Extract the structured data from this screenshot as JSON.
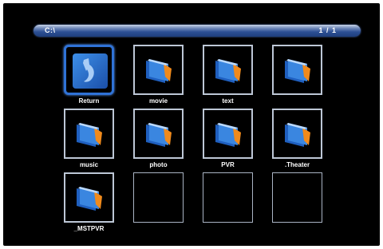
{
  "path_bar": {
    "path": "C:\\",
    "page": "1 / 1"
  },
  "items": [
    {
      "label": "Return",
      "icon": "return-arrow-icon",
      "type": "return"
    },
    {
      "label": "movie",
      "icon": "folder-icon",
      "type": "folder"
    },
    {
      "label": "text",
      "icon": "folder-icon",
      "type": "folder"
    },
    {
      "label": "",
      "icon": "folder-icon",
      "type": "folder"
    },
    {
      "label": "music",
      "icon": "folder-icon",
      "type": "folder"
    },
    {
      "label": "photo",
      "icon": "folder-icon",
      "type": "folder"
    },
    {
      "label": "PVR",
      "icon": "folder-icon",
      "type": "folder"
    },
    {
      "label": ".Theater",
      "icon": "folder-icon",
      "type": "folder"
    },
    {
      "label": "_MSTPVR",
      "icon": "folder-icon",
      "type": "folder"
    },
    {
      "label": "",
      "type": "empty"
    },
    {
      "label": "",
      "type": "empty"
    },
    {
      "label": "",
      "type": "empty"
    }
  ],
  "colors": {
    "background": "#000000",
    "path_bar": "#2c4f94",
    "selection": "#2f72d6",
    "tile_border": "#bdc7d6",
    "folder_blue": "#2a6fd0",
    "folder_orange": "#f08a1c"
  }
}
